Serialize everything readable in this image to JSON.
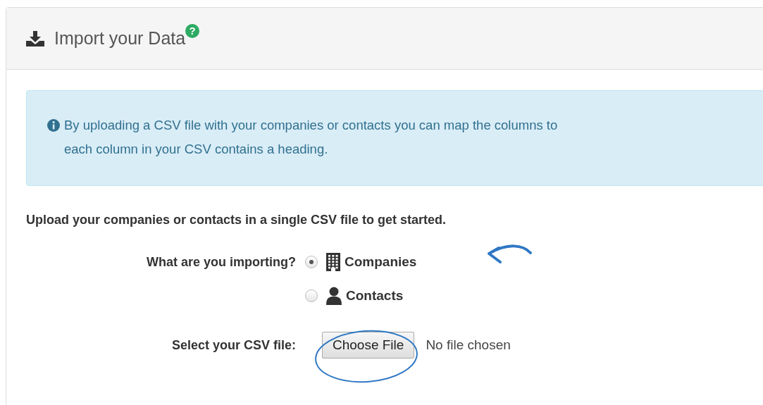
{
  "panel": {
    "title": "Import your Data",
    "help_badge": "?"
  },
  "alert": {
    "text": "By uploading a CSV file with your companies or contacts you can map the columns to\neach column in your CSV contains a heading."
  },
  "intro": "Upload your companies or contacts in a single CSV file to get started.",
  "import_type": {
    "label": "What are you importing?",
    "options": [
      {
        "label": "Companies",
        "kind": "building",
        "selected": true
      },
      {
        "label": "Contacts",
        "kind": "person",
        "selected": false
      }
    ]
  },
  "file": {
    "label": "Select your CSV file:",
    "button": "Choose File",
    "status": "No file chosen"
  }
}
